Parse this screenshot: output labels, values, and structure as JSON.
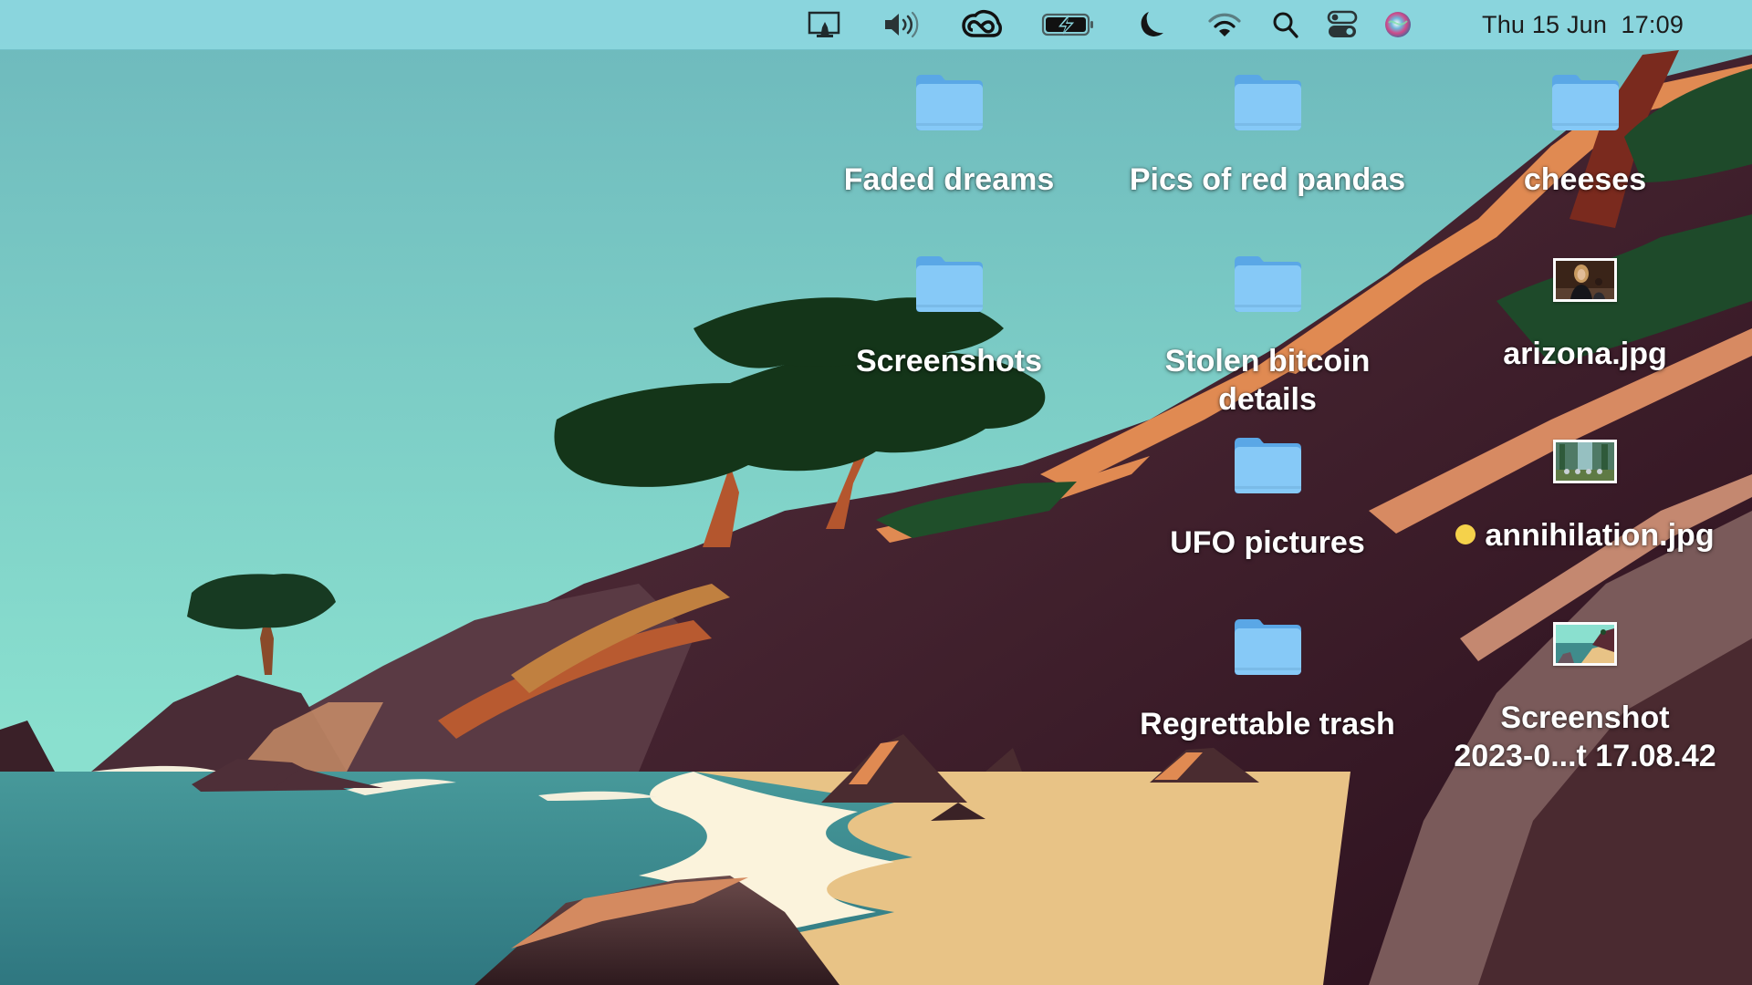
{
  "menubar": {
    "status_icons": [
      {
        "name": "screen-mirroring-icon",
        "label": "Screen Mirroring"
      },
      {
        "name": "volume-icon",
        "label": "Volume"
      },
      {
        "name": "creative-cloud-icon",
        "label": "Creative Cloud"
      },
      {
        "name": "battery-charging-icon",
        "label": "Battery charging"
      },
      {
        "name": "focus-moon-icon",
        "label": "Focus / Do Not Disturb"
      },
      {
        "name": "wifi-icon",
        "label": "Wi-Fi"
      },
      {
        "name": "spotlight-search-icon",
        "label": "Spotlight"
      },
      {
        "name": "control-center-icon",
        "label": "Control Center"
      },
      {
        "name": "siri-icon",
        "label": "Siri"
      }
    ],
    "clock": "Thu 15 Jun  17:09"
  },
  "desktop": {
    "items": [
      {
        "type": "folder",
        "label": "Faded dreams"
      },
      {
        "type": "folder",
        "label": "Pics of red pandas"
      },
      {
        "type": "folder",
        "label": "cheeses"
      },
      {
        "type": "folder",
        "label": "Screenshots"
      },
      {
        "type": "folder",
        "label": "Stolen bitcoin\ndetails"
      },
      {
        "type": "image",
        "label": "arizona.jpg"
      },
      {
        "type": "folder",
        "label": "UFO pictures"
      },
      {
        "type": "image",
        "label": "annihilation.jpg",
        "tag_color": "#f5d24b",
        "tag": "yellow"
      },
      {
        "type": "folder",
        "label": "Regrettable trash"
      },
      {
        "type": "image",
        "label": "Screenshot\n2023-0...t 17.08.42"
      }
    ]
  },
  "colors": {
    "menubar_bg": "#8bd6de",
    "sky_top": "#6db8bc",
    "sky_bottom": "#8ae0cf",
    "water": "#3f8c8c",
    "sand": "#e8c386",
    "cliff": "#3e1d2a",
    "cliff_edge": "#e08a52",
    "folder": "#86c9f7",
    "folder_tab": "#5aa7e6",
    "tag_yellow": "#f5d24b"
  }
}
